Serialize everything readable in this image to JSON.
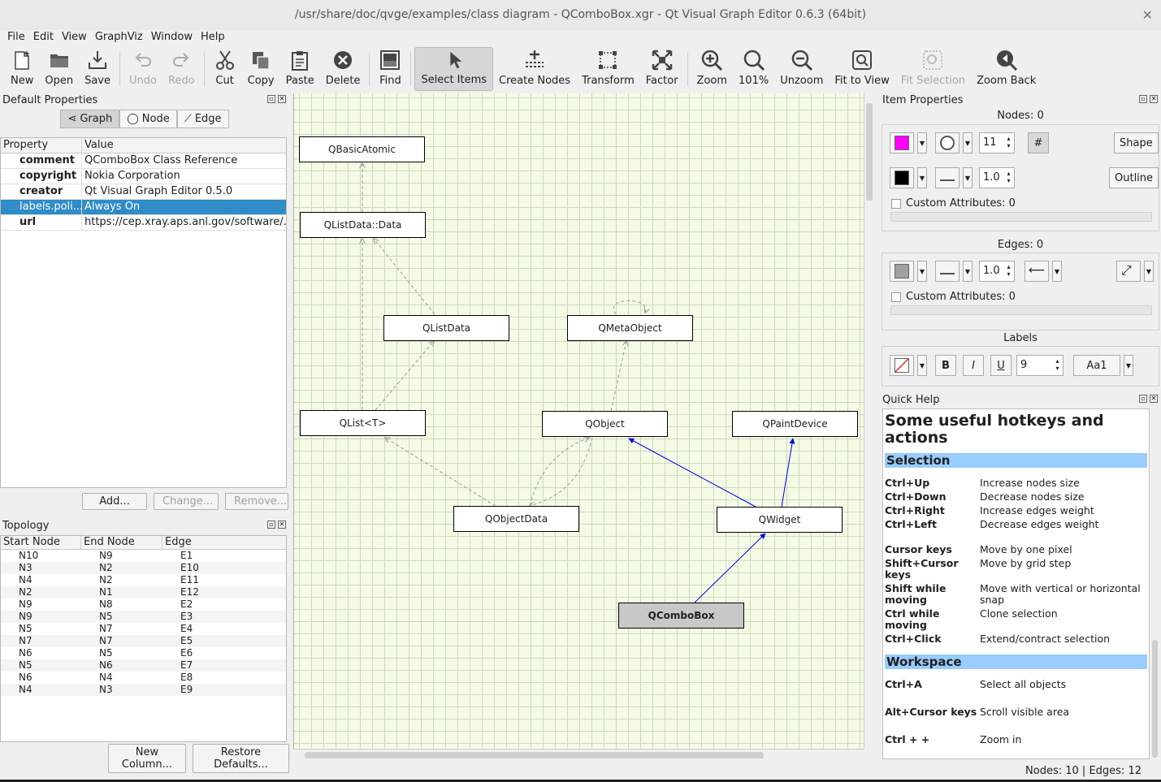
{
  "window": {
    "title": "/usr/share/doc/qvge/examples/class diagram - QComboBox.xgr - Qt Visual Graph Editor 0.6.3 (64bit)"
  },
  "menu": [
    "File",
    "Edit",
    "View",
    "GraphViz",
    "Window",
    "Help"
  ],
  "toolbar": {
    "new": "New",
    "open": "Open",
    "save": "Save",
    "undo": "Undo",
    "redo": "Redo",
    "cut": "Cut",
    "copy": "Copy",
    "paste": "Paste",
    "delete": "Delete",
    "find": "Find",
    "select_items": "Select Items",
    "create_nodes": "Create Nodes",
    "transform": "Transform",
    "factor": "Factor",
    "zoom": "Zoom",
    "zoom_level": "101%",
    "unzoom": "Unzoom",
    "fit_to_view": "Fit to View",
    "fit_selection": "Fit Selection",
    "zoom_back": "Zoom Back"
  },
  "default_properties": {
    "title": "Default Properties",
    "tabs": [
      "Graph",
      "Node",
      "Edge"
    ],
    "columns": [
      "Property",
      "Value"
    ],
    "rows": [
      {
        "key": "comment",
        "value": "QComboBox Class Reference"
      },
      {
        "key": "copyright",
        "value": "Nokia Corporation"
      },
      {
        "key": "creator",
        "value": "Qt Visual Graph Editor 0.5.0"
      },
      {
        "key": "labels.poli...",
        "value": "Always On"
      },
      {
        "key": "url",
        "value": "https://cep.xray.aps.anl.gov/software/..."
      }
    ],
    "buttons": {
      "add": "Add...",
      "change": "Change...",
      "remove": "Remove..."
    }
  },
  "topology": {
    "title": "Topology",
    "columns": [
      "Start Node",
      "End Node",
      "Edge"
    ],
    "rows": [
      [
        "N10",
        "N9",
        "E1"
      ],
      [
        "N3",
        "N2",
        "E10"
      ],
      [
        "N4",
        "N2",
        "E11"
      ],
      [
        "N2",
        "N1",
        "E12"
      ],
      [
        "N9",
        "N8",
        "E2"
      ],
      [
        "N9",
        "N5",
        "E3"
      ],
      [
        "N5",
        "N7",
        "E4"
      ],
      [
        "N7",
        "N7",
        "E5"
      ],
      [
        "N6",
        "N5",
        "E6"
      ],
      [
        "N5",
        "N6",
        "E7"
      ],
      [
        "N6",
        "N4",
        "E8"
      ],
      [
        "N4",
        "N3",
        "E9"
      ]
    ],
    "buttons": {
      "new_column": "New Column...",
      "restore_defaults": "Restore Defaults..."
    }
  },
  "graph": {
    "nodes": {
      "qbasicatomic": "QBasicAtomic",
      "qlistdata_data": "QListData::Data",
      "qlistdata": "QListData",
      "qmetaobject": "QMetaObject",
      "qlist_t": "QList<T>",
      "qobject": "QObject",
      "qpaintdevice": "QPaintDevice",
      "qobjectdata": "QObjectData",
      "qwidget": "QWidget",
      "qcombobox": "QComboBox"
    }
  },
  "item_properties": {
    "title": "Item Properties",
    "nodes_label": "Nodes: 0",
    "node_fill_color": "#ff00ff",
    "node_size": "11",
    "hash_label": "#",
    "shape_label": "Shape",
    "outline_color": "#000000",
    "outline_width": "1.0",
    "outline_label": "Outline",
    "custom_attrs_nodes": "Custom Attributes: 0",
    "edges_label": "Edges: 0",
    "edge_color": "#a0a0a0",
    "edge_width": "1.0",
    "custom_attrs_edges": "Custom Attributes: 0",
    "labels_title": "Labels",
    "bold": "B",
    "italic": "I",
    "underline": "U",
    "label_size": "9",
    "font_label": "Aa1"
  },
  "quick_help": {
    "title": "Quick Help",
    "heading": "Some useful hotkeys and actions",
    "selection_title": "Selection",
    "selection": [
      {
        "k": "Ctrl+Up",
        "v": "Increase nodes size"
      },
      {
        "k": "Ctrl+Down",
        "v": "Decrease nodes size"
      },
      {
        "k": "Ctrl+Right",
        "v": "Increase edges weight"
      },
      {
        "k": "Ctrl+Left",
        "v": "Decrease edges weight"
      }
    ],
    "moving": [
      {
        "k": "Cursor keys",
        "v": "Move by one pixel"
      },
      {
        "k": "Shift+Cursor keys",
        "v": "Move by grid step"
      },
      {
        "k": "Shift while moving",
        "v": "Move with vertical or horizontal snap"
      },
      {
        "k": "Ctrl while moving",
        "v": "Clone selection"
      },
      {
        "k": "Ctrl+Click",
        "v": "Extend/contract selection"
      }
    ],
    "workspace_title": "Workspace",
    "workspace": [
      {
        "k": "Ctrl+A",
        "v": "Select all objects"
      },
      {
        "k": "Alt+Cursor keys",
        "v": "Scroll visible area"
      },
      {
        "k": "Ctrl + +",
        "v": "Zoom in"
      }
    ]
  },
  "status": {
    "text": "Nodes: 10 | Edges: 12"
  }
}
